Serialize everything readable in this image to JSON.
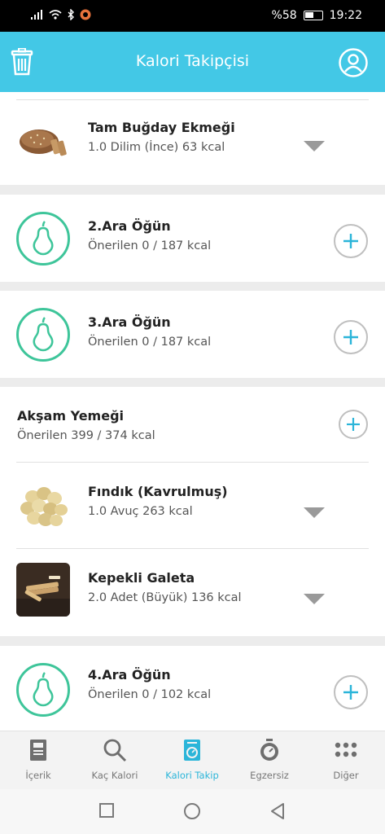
{
  "status": {
    "battery": "%58",
    "time": "19:22"
  },
  "header": {
    "title": "Kalori Takipçisi"
  },
  "items": {
    "bread": {
      "name": "Tam Buğday Ekmeği",
      "detail": "1.0 Dilim (İnce) 63 kcal"
    },
    "snack2": {
      "name": "2.Ara Öğün",
      "detail": "Önerilen 0 / 187 kcal"
    },
    "snack3": {
      "name": "3.Ara Öğün",
      "detail": "Önerilen 0 / 187 kcal"
    },
    "dinner": {
      "name": "Akşam Yemeği",
      "detail": "Önerilen 399 / 374 kcal"
    },
    "hazelnut": {
      "name": "Fındık (Kavrulmuş)",
      "detail": "1.0 Avuç 263 kcal"
    },
    "cracker": {
      "name": "Kepekli Galeta",
      "detail": "2.0 Adet (Büyük) 136 kcal"
    },
    "snack4": {
      "name": "4.Ara Öğün",
      "detail": "Önerilen 0 / 102 kcal"
    }
  },
  "tabs": [
    {
      "label": "İçerik",
      "icon": "book-icon"
    },
    {
      "label": "Kaç Kalori",
      "icon": "search-icon"
    },
    {
      "label": "Kalori Takip",
      "icon": "scale-icon",
      "active": true
    },
    {
      "label": "Egzersiz",
      "icon": "stopwatch-icon"
    },
    {
      "label": "Diğer",
      "icon": "grid-dots-icon"
    }
  ],
  "colors": {
    "accent": "#43c8e6",
    "active_tab": "#2bb5d9",
    "pear": "#3ec59a"
  }
}
